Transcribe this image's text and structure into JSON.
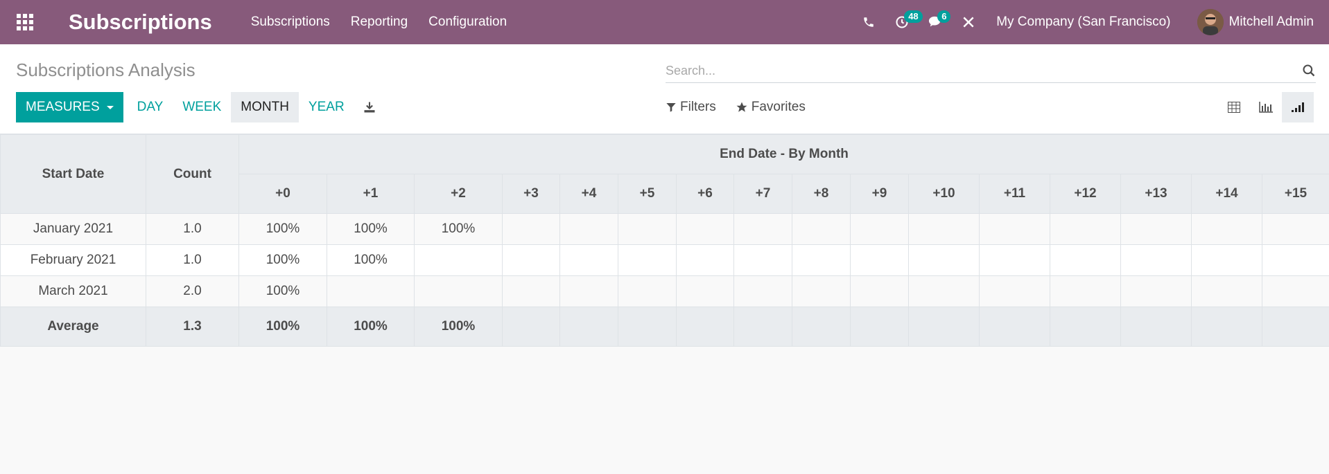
{
  "navbar": {
    "brand": "Subscriptions",
    "menu": [
      "Subscriptions",
      "Reporting",
      "Configuration"
    ],
    "activity_count": "48",
    "message_count": "6",
    "company": "My Company (San Francisco)",
    "user": "Mitchell Admin"
  },
  "control_panel": {
    "title": "Subscriptions Analysis",
    "search_placeholder": "Search...",
    "measures_label": "MEASURES",
    "intervals": [
      "DAY",
      "WEEK",
      "MONTH",
      "YEAR"
    ],
    "active_interval": "MONTH",
    "filters_label": "Filters",
    "favorites_label": "Favorites"
  },
  "cohort": {
    "col_start": "Start Date",
    "col_count": "Count",
    "group_header": "End Date - By Month",
    "periods": [
      "+0",
      "+1",
      "+2",
      "+3",
      "+4",
      "+5",
      "+6",
      "+7",
      "+8",
      "+9",
      "+10",
      "+11",
      "+12",
      "+13",
      "+14",
      "+15"
    ],
    "rows": [
      {
        "label": "January 2021",
        "count": "1.0",
        "values": [
          "100%",
          "100%",
          "100%",
          "",
          "",
          "",
          "",
          "",
          "",
          "",
          "",
          "",
          "",
          "",
          "",
          ""
        ]
      },
      {
        "label": "February 2021",
        "count": "1.0",
        "values": [
          "100%",
          "100%",
          "",
          "",
          "",
          "",
          "",
          "",
          "",
          "",
          "",
          "",
          "",
          "",
          "",
          ""
        ]
      },
      {
        "label": "March 2021",
        "count": "2.0",
        "values": [
          "100%",
          "",
          "",
          "",
          "",
          "",
          "",
          "",
          "",
          "",
          "",
          "",
          "",
          "",
          "",
          ""
        ]
      }
    ],
    "footer": {
      "label": "Average",
      "count": "1.3",
      "values": [
        "100%",
        "100%",
        "100%",
        "",
        "",
        "",
        "",
        "",
        "",
        "",
        "",
        "",
        "",
        "",
        "",
        ""
      ]
    }
  },
  "colors": {
    "navbar": "#875a7b",
    "accent": "#00a09d"
  }
}
